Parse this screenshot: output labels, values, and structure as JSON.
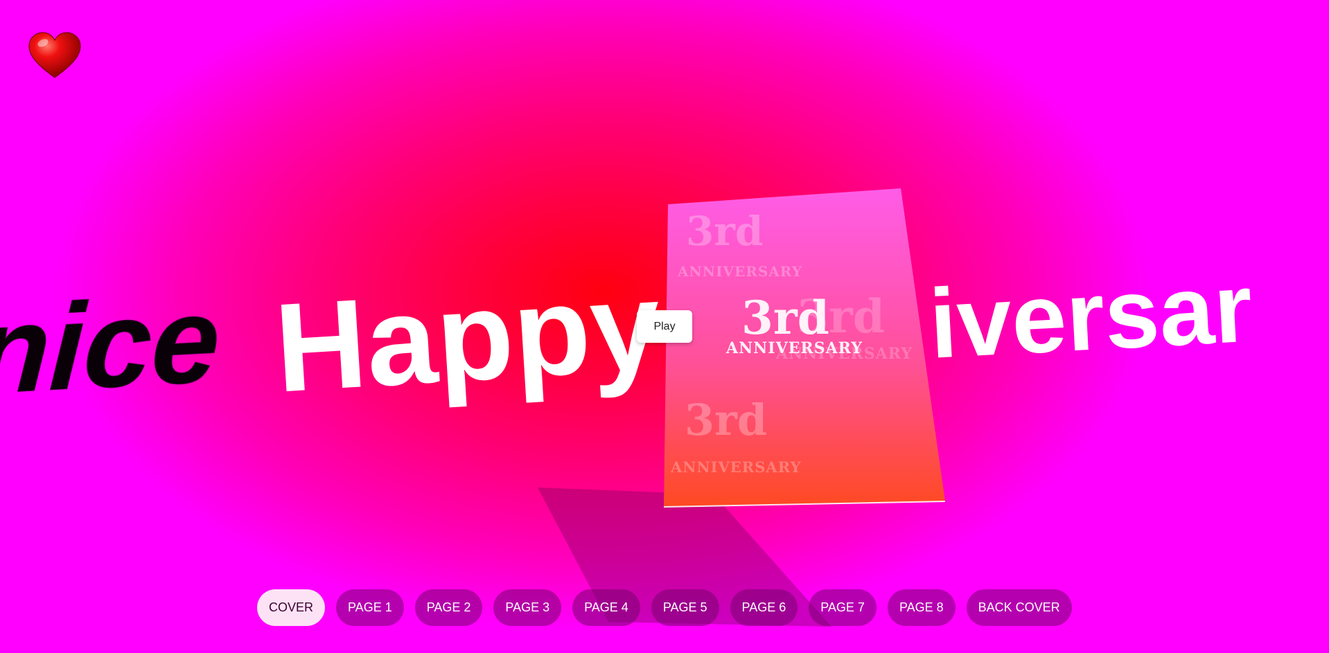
{
  "marquee": {
    "left_fragment": "nice",
    "middle_word": "Happy",
    "right_fragment": "iversar"
  },
  "card": {
    "big_text": "3rd",
    "small_text": "ANNIVERSARY",
    "colors": {
      "top": "#ff5ce8",
      "bottom": "#ff4a22"
    }
  },
  "play_button": {
    "label": "Play"
  },
  "nav": {
    "active_index": 0,
    "items": [
      {
        "label": "COVER"
      },
      {
        "label": "PAGE 1"
      },
      {
        "label": "PAGE 2"
      },
      {
        "label": "PAGE 3"
      },
      {
        "label": "PAGE 4"
      },
      {
        "label": "PAGE 5"
      },
      {
        "label": "PAGE 6"
      },
      {
        "label": "PAGE 7"
      },
      {
        "label": "PAGE 8"
      },
      {
        "label": "BACK COVER"
      }
    ]
  },
  "icons": {
    "heart": "heart-icon"
  },
  "colors": {
    "background_edge": "#ff00ff",
    "background_center": "#ff0010",
    "nav_button": "#78006e",
    "nav_active": "#fde2f6"
  }
}
